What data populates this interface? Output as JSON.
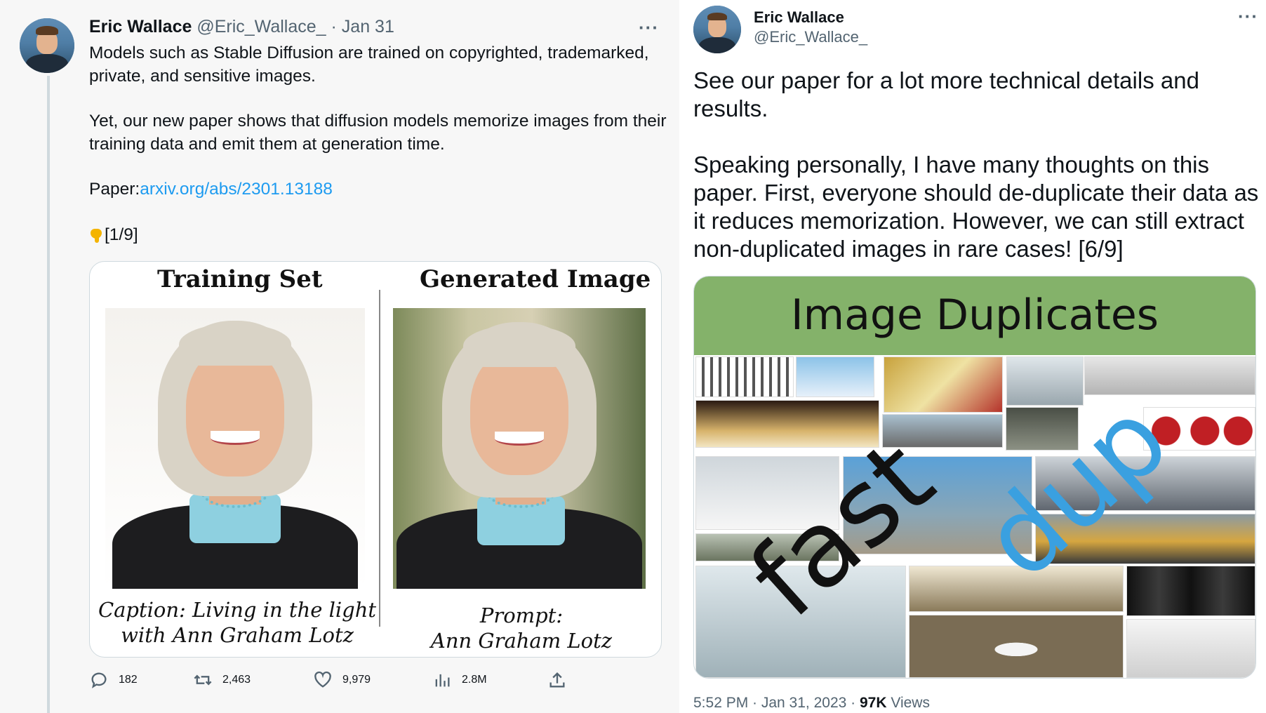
{
  "left_tweet": {
    "name": "Eric Wallace",
    "handle": "@Eric_Wallace_",
    "date": "· Jan 31",
    "more": "···",
    "para1": "Models such as Stable Diffusion are trained on copyrighted, trademarked, private, and sensitive images.",
    "para2": "Yet, our new paper shows that diffusion models memorize images from their training data and emit them at generation time.",
    "paper_label": "Paper:",
    "paper_link": "arxiv.org/abs/2301.13188",
    "counter": "[1/9]",
    "media": {
      "title_left": "Training Set",
      "title_right": "Generated Image",
      "caption_left_1": "Caption: Living in the light",
      "caption_left_2": "with Ann Graham Lotz",
      "caption_right_1": "Prompt:",
      "caption_right_2": "Ann Graham Lotz"
    },
    "actions": {
      "replies": "182",
      "retweets": "2,463",
      "likes": "9,979",
      "views": "2.8M"
    },
    "icons": [
      "reply-icon",
      "retweet-icon",
      "like-icon",
      "views-icon",
      "share-icon"
    ]
  },
  "right_tweet": {
    "name": "Eric Wallace",
    "handle": "@Eric_Wallace_",
    "more": "···",
    "para1": "See our paper for a lot more technical details and results.",
    "para2": "Speaking personally, I have many thoughts on this paper. First, everyone should de-duplicate their data as it reduces memorization. However, we can still extract non-duplicated images in rare cases! [6/9]",
    "media": {
      "banner_title": "Image Duplicates",
      "overlay_word_1": "fast",
      "overlay_word_2": "dup"
    },
    "footer": {
      "time": "5:52 PM · Jan 31, 2023 · ",
      "views_count": "97K",
      "views_label": " Views"
    }
  },
  "colors": {
    "link": "#1d9bf0",
    "banner_green": "#84b26a",
    "overlay_blue": "#3aa0e0",
    "muted": "#536471"
  }
}
